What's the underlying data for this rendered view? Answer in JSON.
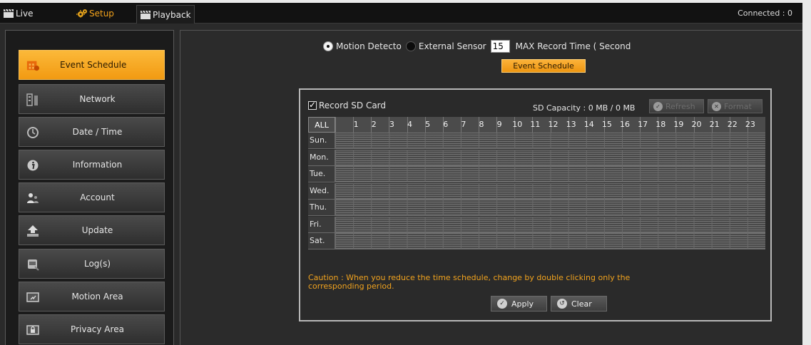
{
  "topbar": {
    "tabs": [
      {
        "label": "Live",
        "icon": "clapper-icon"
      },
      {
        "label": "Setup",
        "icon": "gear-icon",
        "active": true
      },
      {
        "label": "Playback",
        "icon": "clapper-icon"
      }
    ],
    "connected": "Connected : 0"
  },
  "sidebar": {
    "items": [
      {
        "label": "Event Schedule",
        "icon": "calendar-icon",
        "active": true
      },
      {
        "label": "Network",
        "icon": "network-icon"
      },
      {
        "label": "Date / Time",
        "icon": "clock-icon"
      },
      {
        "label": "Information",
        "icon": "info-icon"
      },
      {
        "label": "Account",
        "icon": "users-icon"
      },
      {
        "label": "Update",
        "icon": "upload-icon"
      },
      {
        "label": "Log(s)",
        "icon": "log-icon"
      },
      {
        "label": "Motion Area",
        "icon": "motion-icon"
      },
      {
        "label": "Privacy Area",
        "icon": "lock-icon"
      }
    ]
  },
  "trigger": {
    "motion_label": "Motion Detecto",
    "motion_selected": true,
    "sensor_label": "External Sensor",
    "sensor_selected": false,
    "max_record_value": "15",
    "max_record_label": "MAX Record Time ( Second",
    "event_schedule_button": "Event Schedule"
  },
  "schedule": {
    "record_sd_label": "Record SD Card",
    "record_sd_checked": true,
    "capacity": "SD Capacity : 0 MB / 0 MB",
    "refresh_label": "Refresh",
    "format_label": "Format",
    "all_label": "ALL",
    "hours": [
      "1",
      "2",
      "3",
      "4",
      "5",
      "6",
      "7",
      "8",
      "9",
      "10",
      "11",
      "12",
      "13",
      "14",
      "15",
      "16",
      "17",
      "18",
      "19",
      "20",
      "21",
      "22",
      "23"
    ],
    "days": [
      "Sun.",
      "Mon.",
      "Tue.",
      "Wed.",
      "Thu.",
      "Fri.",
      "Sat."
    ],
    "caution": "Caution : When you reduce the time schedule, change by double clicking only the corresponding period.",
    "apply_label": "Apply",
    "clear_label": "Clear"
  },
  "colors": {
    "accent": "#f29a12",
    "caution": "#f0a21e",
    "topbar_bg": "#121212"
  }
}
